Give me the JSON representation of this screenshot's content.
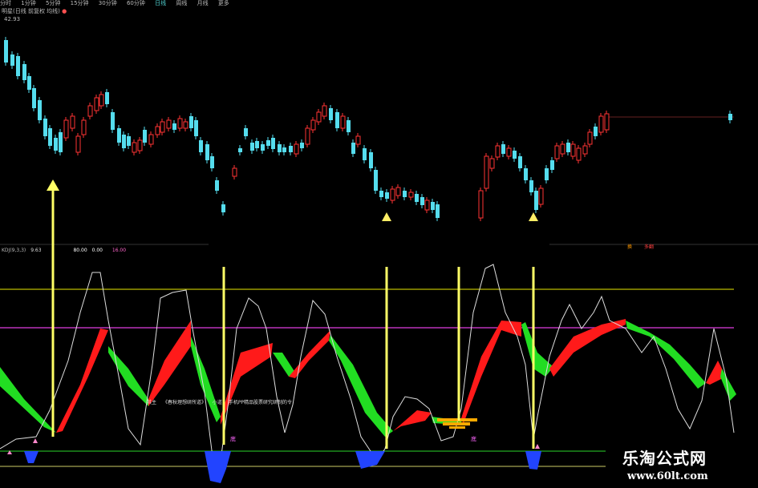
{
  "toolbar": {
    "periods": [
      "分时",
      "1分钟",
      "5分钟",
      "15分钟",
      "30分钟",
      "60分钟",
      "日线",
      "周线",
      "月线",
      "更多"
    ],
    "selected_index": 6
  },
  "main_chart": {
    "indicator_title": "明星(日线 前复权 均线)",
    "price_label": "42.93"
  },
  "kdj": {
    "name": "KDJ(9,3,3)",
    "k_value": "9.63",
    "d_value": "80.00",
    "j_value": "0.00",
    "extra_value": "16.00"
  },
  "badges": [
    "换",
    "多翻"
  ],
  "note_text": [
    "其主",
    "《春秋理想研所道》",
    "小道",
    "手机PP精品股票研究研制的令"
  ],
  "purple_marks": [
    "底",
    "底"
  ],
  "watermark": {
    "brand": "乐淘公式网",
    "url": "www.60lt.com"
  },
  "colors": {
    "up_candle": "#ff3333",
    "down_candle": "#55ddee",
    "red_band": "#ff1a1a",
    "green_band": "#22dd22",
    "signal_arrow": "#ffff66",
    "blue_fill": "#2244ff",
    "orange_bar": "#ffaa00",
    "level_upper": "#cccc00",
    "level_purple": "#cc33cc",
    "level_lower": "#22aa22"
  }
}
